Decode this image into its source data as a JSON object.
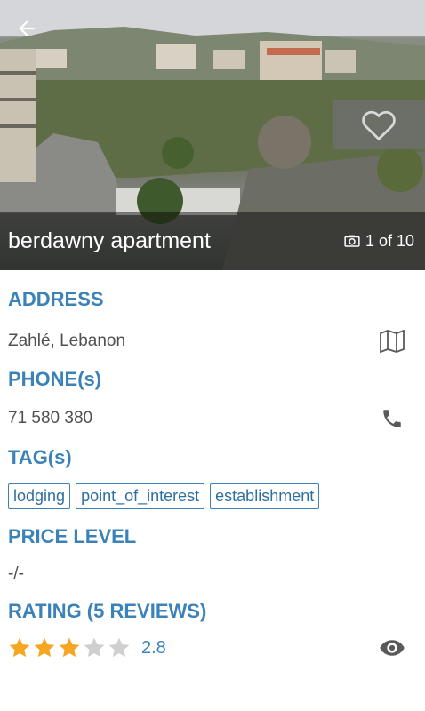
{
  "hero": {
    "title": "berdawny apartment",
    "photo_counter": "1 of 10"
  },
  "address": {
    "heading": "ADDRESS",
    "value": "Zahlé, Lebanon",
    "icon": "map-icon"
  },
  "phone": {
    "heading": "PHONE(s)",
    "value": "71 580 380",
    "icon": "phone-icon"
  },
  "tags": {
    "heading": "TAG(s)",
    "items": [
      "lodging",
      "point_of_interest",
      "establishment"
    ]
  },
  "price": {
    "heading": "PRICE LEVEL",
    "value": "-/-"
  },
  "rating": {
    "heading": "RATING (5 REVIEWS)",
    "value": "2.8",
    "stars_filled": 3,
    "stars_total": 5,
    "star_color": "#f5a623",
    "star_empty_color": "#cfcfcf",
    "icon": "eye-icon"
  },
  "colors": {
    "accent": "#3b82b8",
    "text": "#505050"
  }
}
